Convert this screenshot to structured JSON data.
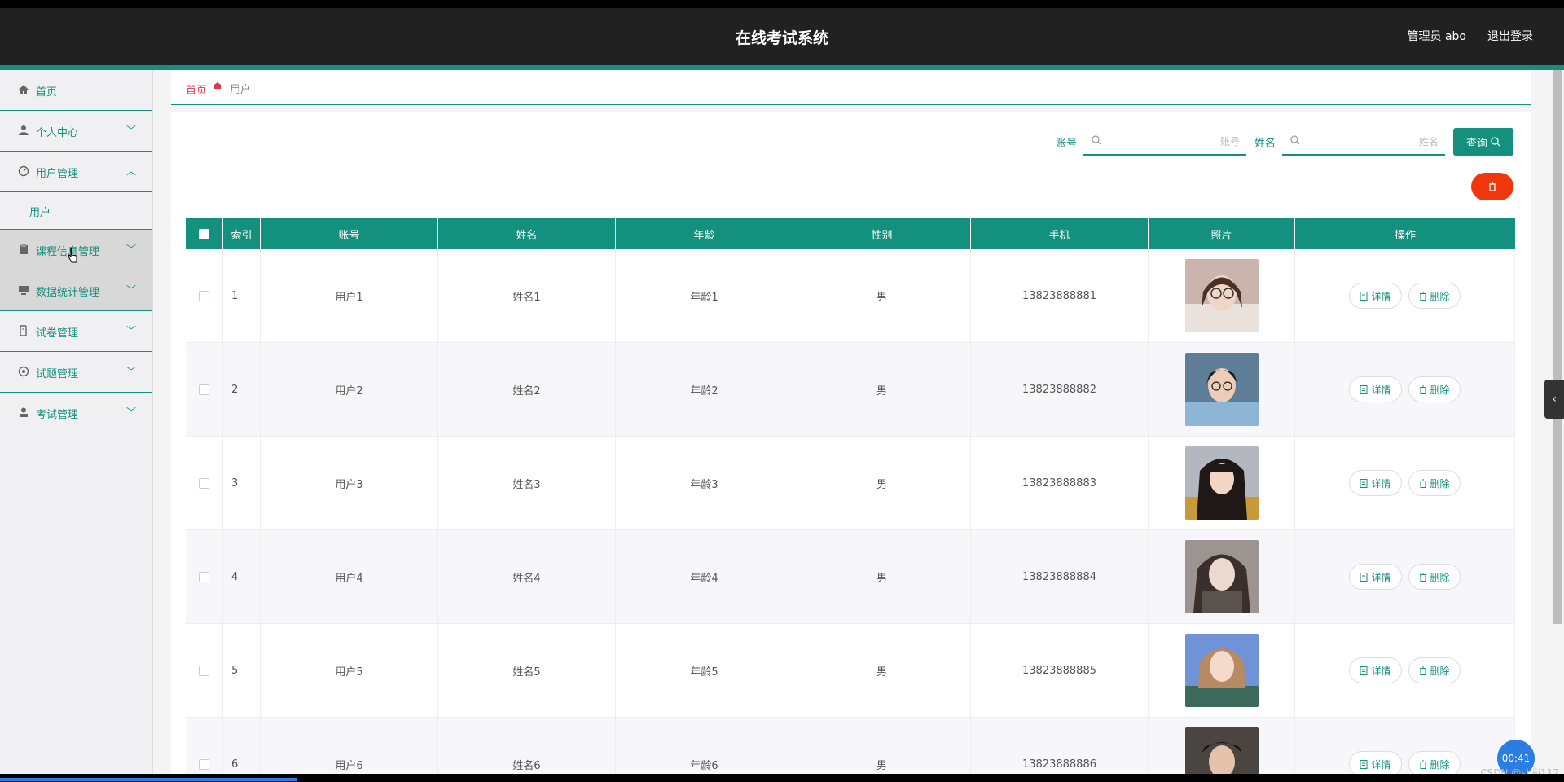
{
  "header": {
    "title": "在线考试系统",
    "user": "管理员 abo",
    "logout": "退出登录"
  },
  "sidebar": {
    "items": [
      {
        "label": "首页",
        "icon": "home-icon"
      },
      {
        "label": "个人中心",
        "icon": "person-icon"
      },
      {
        "label": "用户管理",
        "icon": "dashboard-icon",
        "expanded": true,
        "children": [
          {
            "label": "用户"
          }
        ]
      },
      {
        "label": "课程信息管理",
        "icon": "clipboard-icon"
      },
      {
        "label": "数据统计管理",
        "icon": "monitor-icon"
      },
      {
        "label": "试卷管理",
        "icon": "paper-icon"
      },
      {
        "label": "试题管理",
        "icon": "target-icon"
      },
      {
        "label": "考试管理",
        "icon": "user-icon"
      }
    ]
  },
  "breadcrumb": {
    "home": "首页",
    "current": "用户"
  },
  "search": {
    "account_label": "账号",
    "account_placeholder": "账号",
    "name_label": "姓名",
    "name_placeholder": "姓名",
    "query_button": "查询"
  },
  "table": {
    "headers": [
      "索引",
      "账号",
      "姓名",
      "年龄",
      "性别",
      "手机",
      "照片",
      "操作"
    ],
    "rows": [
      {
        "index": "1",
        "account": "用户1",
        "name": "姓名1",
        "age": "年龄1",
        "gender": "男",
        "phone": "13823888881"
      },
      {
        "index": "2",
        "account": "用户2",
        "name": "姓名2",
        "age": "年龄2",
        "gender": "男",
        "phone": "13823888882"
      },
      {
        "index": "3",
        "account": "用户3",
        "name": "姓名3",
        "age": "年龄3",
        "gender": "男",
        "phone": "13823888883"
      },
      {
        "index": "4",
        "account": "用户4",
        "name": "姓名4",
        "age": "年龄4",
        "gender": "男",
        "phone": "13823888884"
      },
      {
        "index": "5",
        "account": "用户5",
        "name": "姓名5",
        "age": "年龄5",
        "gender": "男",
        "phone": "13823888885"
      },
      {
        "index": "6",
        "account": "用户6",
        "name": "姓名6",
        "age": "年龄6",
        "gender": "男",
        "phone": "13823888886"
      }
    ],
    "detail_button": "详情",
    "delete_button": "删除"
  },
  "overlay": {
    "timer": "00:41",
    "watermark": "CSDN @shiji117"
  },
  "colors": {
    "accent": "#14917e",
    "danger": "#f0360d",
    "header_bg": "#212121",
    "home_link": "#e3334a"
  }
}
